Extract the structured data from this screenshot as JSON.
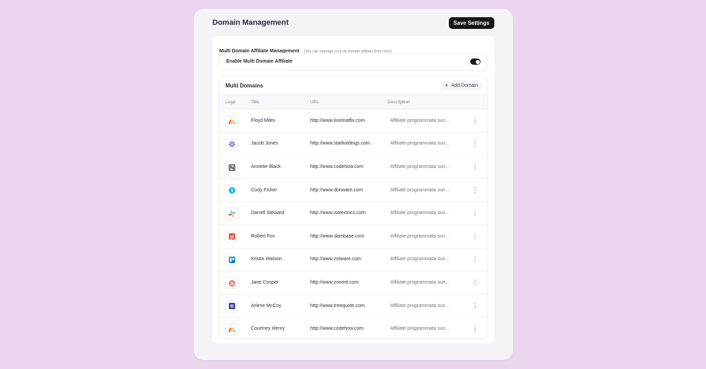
{
  "header": {
    "title": "Domain Management",
    "save_label": "Save Settings"
  },
  "settings": {
    "title": "Multi Domain Affiliate Management",
    "note": "(You can manage your all domain affiliate from here)",
    "toggle_label": "Enable Multi Domain Affiliate",
    "toggle_on": true
  },
  "domains": {
    "title": "Multi Domains",
    "add_label": "Add Domain",
    "columns": {
      "logo": "Logo",
      "title": "Title",
      "url": "URL",
      "description": "Description"
    },
    "rows": [
      {
        "logo": "monday-icon",
        "title": "Floyd Miles",
        "url": "http://www.konmatfix.com",
        "description": "Affiliate programmata sun..."
      },
      {
        "logo": "burst-icon",
        "title": "Jacob Jones",
        "url": "http://www.statholdings.com",
        "description": "Affiliate programmata sun..."
      },
      {
        "logo": "notion-icon",
        "title": "Annette Black",
        "url": "http://www.codehow.com",
        "description": "Affiliate programmata sun..."
      },
      {
        "logo": "skype-icon",
        "title": "Cody Fisher",
        "url": "http://www.donware.com",
        "description": "Affiliate programmata sun..."
      },
      {
        "logo": "slack-icon",
        "title": "Darrell Steward",
        "url": "http://www.iselectrics.com",
        "description": "Affiliate programmata sun..."
      },
      {
        "logo": "todoist-icon",
        "title": "Robert Fox",
        "url": "http://www.dambase.com",
        "description": "Affiliate programmata sun..."
      },
      {
        "logo": "trello-icon",
        "title": "Kristin Watson",
        "url": "http://www.zotware.com",
        "description": "Affiliate programmata sun..."
      },
      {
        "logo": "asana-icon",
        "title": "Jane Cooper",
        "url": "http://www.zoomit.com",
        "description": "Affiliate programmata sun..."
      },
      {
        "logo": "orb-icon",
        "title": "Arlene McCoy",
        "url": "http://www.treequote.com",
        "description": "Affiliate programmata sun..."
      },
      {
        "logo": "monday-icon",
        "title": "Courtney Henry",
        "url": "http://www.codehow.com",
        "description": "Affiliate programmata sun..."
      }
    ]
  },
  "colors": {
    "background": "#ecd6ef",
    "panel": "#f3f3f8",
    "accent": "#15161c"
  }
}
